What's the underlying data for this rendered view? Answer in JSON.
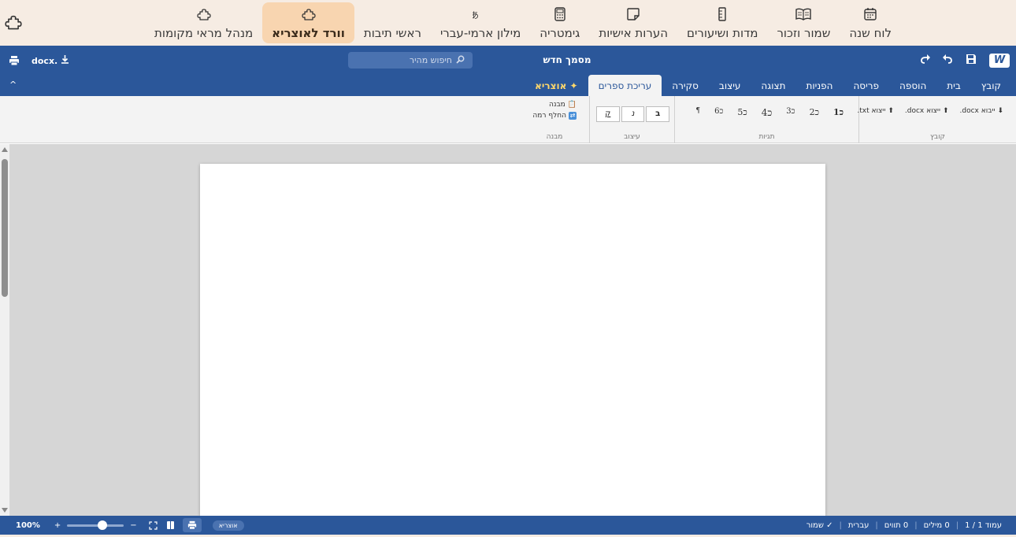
{
  "topnav": {
    "tools": [
      {
        "label": "לוח שנה",
        "icon": "calendar-icon"
      },
      {
        "label": "שמור וזכור",
        "icon": "book-open-icon"
      },
      {
        "label": "מדות ושיעורים",
        "icon": "ruler-icon"
      },
      {
        "label": "הערות אישיות",
        "icon": "sticky-note-icon"
      },
      {
        "label": "גימטריה",
        "icon": "calculator-icon"
      },
      {
        "label": "מילון ארמי-עברי",
        "icon": "translate-icon"
      },
      {
        "label": "ראשי תיבות",
        "icon": "quote-icon"
      },
      {
        "label": "וורד לאוצריא",
        "icon": "puzzle-icon",
        "active": true
      },
      {
        "label": "מנהל מראי מקומות",
        "icon": "puzzle-icon"
      }
    ]
  },
  "titlebar": {
    "logo": "W",
    "doc_title": "מסמך חדש",
    "search_placeholder": "חיפוש מהיר",
    "download_label": "docx."
  },
  "tabs": [
    {
      "label": "קובץ"
    },
    {
      "label": "בית"
    },
    {
      "label": "הוספה"
    },
    {
      "label": "פריסה"
    },
    {
      "label": "הפניות"
    },
    {
      "label": "תצוגה"
    },
    {
      "label": "עיצוב"
    },
    {
      "label": "סקירה"
    },
    {
      "label": "עריכת ספרים",
      "active": true
    },
    {
      "label": "✦ אוצריא",
      "special": true
    }
  ],
  "ribbon": {
    "file_group": {
      "name": "קובץ",
      "buttons": [
        "ייבוא docx.",
        "ייצוא docx.",
        "ייצוא txt."
      ]
    },
    "tags_group": {
      "name": "תגיות",
      "headings": [
        "כ1",
        "כ2",
        "כ3",
        "כ4",
        "כ5",
        "כ6",
        "¶"
      ]
    },
    "format_group": {
      "name": "עיצוב",
      "buttons": [
        "ב",
        "נ",
        "ק"
      ]
    },
    "structure_group": {
      "name": "מבנה",
      "buttons": [
        "מבנה",
        "החלף רמה"
      ]
    }
  },
  "status": {
    "page": "עמוד 1 / 1",
    "words": "0 מילים",
    "chars": "0 תווים",
    "language": "עברית",
    "saved": "✓ שמור",
    "mode_pill": "אוצריא",
    "zoom": "100%",
    "zoom_fraction": 0.62
  },
  "colors": {
    "word_blue": "#2b579a",
    "nav_bg": "#f6ece3",
    "active_tool": "#f8d5b0",
    "otzaria_gold": "#ffd86b"
  }
}
